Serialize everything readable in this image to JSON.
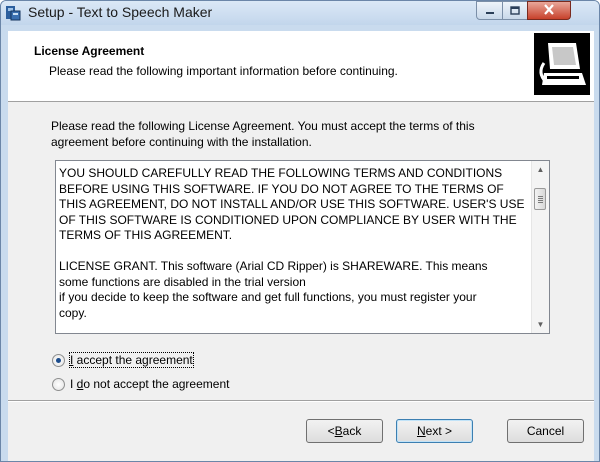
{
  "window": {
    "title": "Setup - Text to Speech Maker",
    "app_icon": "setup-icon"
  },
  "titlebar_buttons": {
    "minimize_icon": "minimize-icon",
    "maximize_icon": "maximize-icon",
    "close_icon": "close-icon"
  },
  "header": {
    "title": "License Agreement",
    "subtitle": "Please read the following important information before continuing.",
    "image_icon": "setup-wizard-image"
  },
  "intro_text": "Please read the following License Agreement. You must accept the terms of this agreement before continuing with the installation.",
  "license_text": "YOU SHOULD CAREFULLY READ THE FOLLOWING TERMS AND CONDITIONS\nBEFORE USING THIS SOFTWARE. IF YOU DO NOT AGREE TO THE TERMS OF\nTHIS AGREEMENT, DO NOT INSTALL AND/OR USE THIS SOFTWARE. USER'S USE\nOF THIS SOFTWARE IS CONDITIONED UPON COMPLIANCE BY USER WITH THE\nTERMS OF THIS AGREEMENT.\n\nLICENSE GRANT. This software (Arial CD Ripper) is SHAREWARE. This means\nsome functions are disabled in the trial version\nif you decide to keep the software and get full functions, you must register your\ncopy.",
  "radios": {
    "accept": {
      "pre": "",
      "accel": "I",
      "post": " accept the agreement",
      "selected": true
    },
    "decline": {
      "pre": "I ",
      "accel": "d",
      "post": "o not accept the agreement",
      "selected": false
    }
  },
  "buttons": {
    "back": {
      "pre": "< ",
      "accel": "B",
      "post": "ack"
    },
    "next": {
      "pre": "",
      "accel": "N",
      "post": "ext >"
    },
    "cancel": {
      "pre": "Cancel",
      "accel": "",
      "post": ""
    }
  },
  "colors": {
    "accent": "#1b4c8c",
    "close_red": "#c7412b",
    "frame": "#c9dbee"
  }
}
